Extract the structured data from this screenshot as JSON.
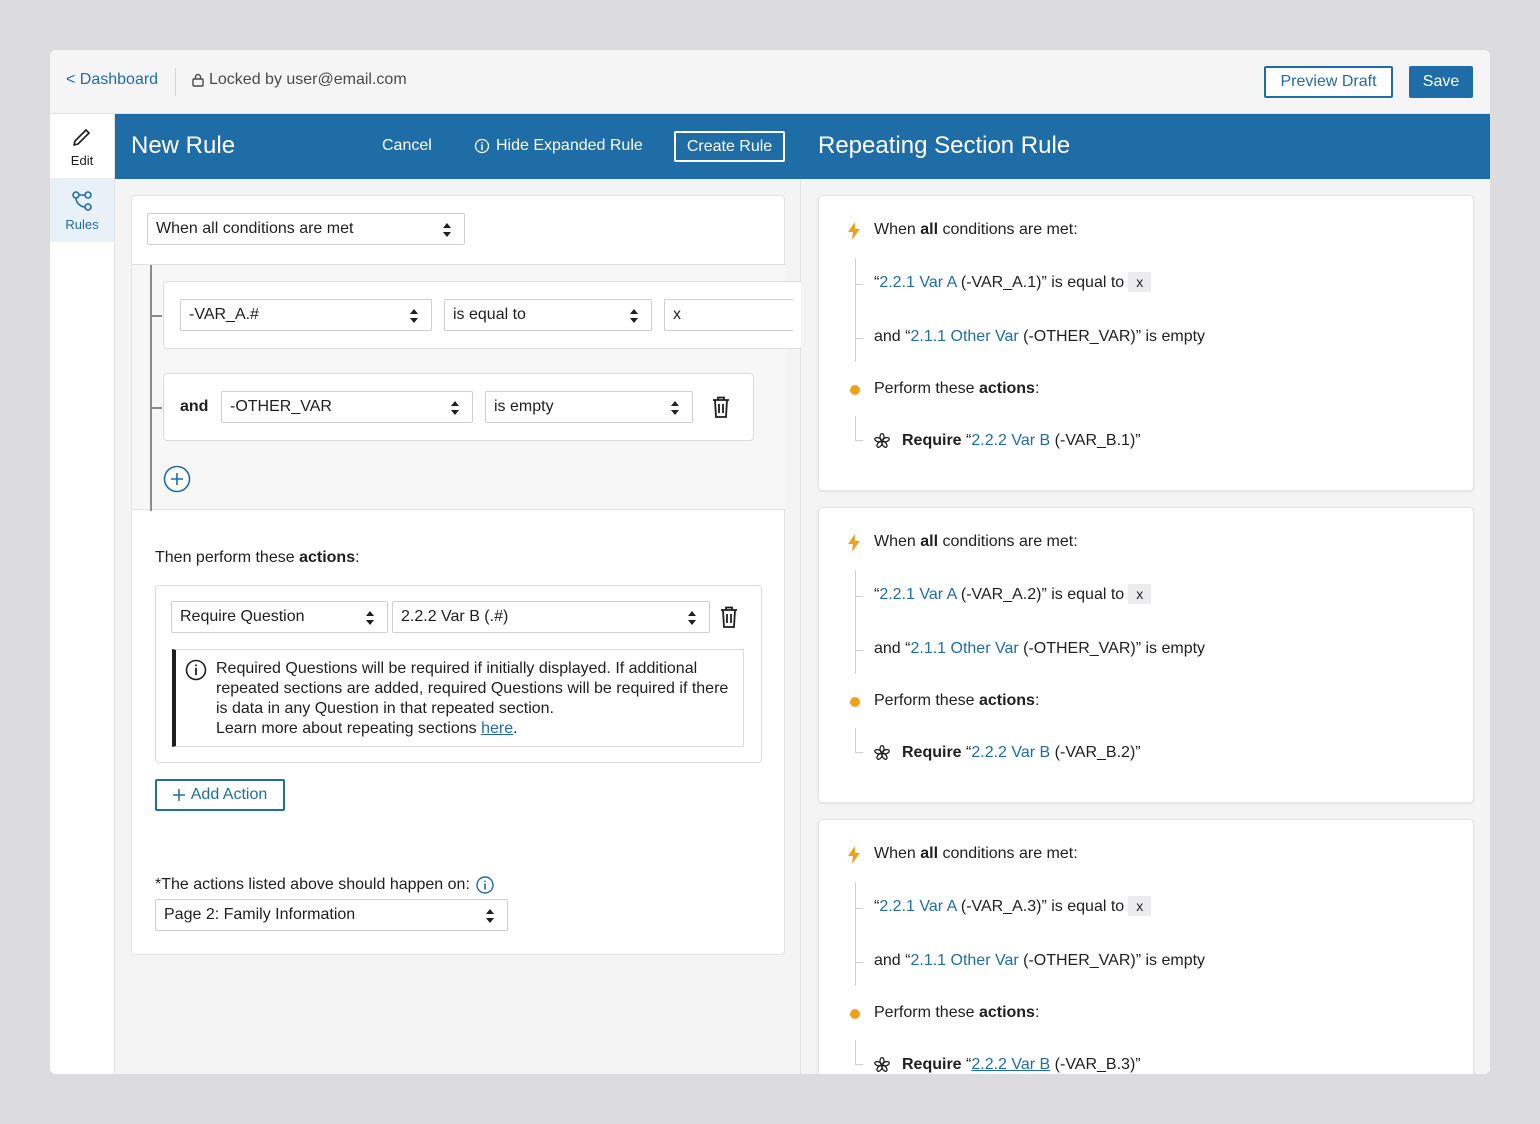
{
  "topbar": {
    "back_label": "< Dashboard",
    "locked_label": "Locked by user@email.com",
    "preview_label": "Preview Draft",
    "save_label": "Save"
  },
  "rail": {
    "edit_label": "Edit",
    "rules_label": "Rules"
  },
  "editor": {
    "title": "New Rule",
    "cancel_label": "Cancel",
    "hide_label": "Hide Expanded Rule",
    "create_label": "Create Rule",
    "match_select": "When all conditions are met",
    "conditions": [
      {
        "prefix": "",
        "variable": "-VAR_A.#",
        "operator": "is equal to",
        "value": "x"
      },
      {
        "prefix": "and",
        "variable": "-OTHER_VAR",
        "operator": "is empty",
        "value": ""
      }
    ],
    "actions_intro": "Then perform these ",
    "actions_bold": "actions",
    "actions_colon": ":",
    "action": {
      "type": "Require Question",
      "target": "2.2.2 Var B (.#)",
      "info_text": "Required Questions will be required if initially displayed. If additional repeated sections are added, required Questions will be required if there is data in any Question in that repeated section.",
      "learn_more": "Learn more about repeating sections ",
      "learn_link": "here",
      "learn_end": "."
    },
    "add_action_label": "Add Action",
    "page_prompt": "*The actions listed above should happen on:",
    "page_select": "Page 2: Family Information"
  },
  "preview": {
    "title": "Repeating Section Rule",
    "rules": [
      {
        "when_pre": "When ",
        "when_bold": "all",
        "when_post": " conditions are met:",
        "c1_open": "“",
        "c1_link": "2.2.1 Var A",
        "c1_rest": " (-VAR_A.1)” is equal to",
        "c1_value": "x",
        "c2_pre": "and “",
        "c2_link": "2.1.1 Other Var",
        "c2_rest": " (-OTHER_VAR)” is empty",
        "perform_pre": "Perform these ",
        "perform_bold": "actions",
        "perform_post": ":",
        "req_bold": "Require",
        "req_open": " “",
        "req_link": "2.2.2 Var B",
        "req_rest": " (-VAR_B.1)”"
      },
      {
        "when_pre": "When ",
        "when_bold": "all",
        "when_post": " conditions are met:",
        "c1_open": "“",
        "c1_link": "2.2.1 Var A",
        "c1_rest": " (-VAR_A.2)” is equal to",
        "c1_value": "x",
        "c2_pre": "and “",
        "c2_link": "2.1.1 Other Var",
        "c2_rest": " (-OTHER_VAR)” is empty",
        "perform_pre": "Perform these ",
        "perform_bold": "actions",
        "perform_post": ":",
        "req_bold": "Require",
        "req_open": " “",
        "req_link": "2.2.2 Var B",
        "req_rest": " (-VAR_B.2)”"
      },
      {
        "when_pre": "When ",
        "when_bold": "all",
        "when_post": " conditions are met:",
        "c1_open": "“",
        "c1_link": "2.2.1 Var A",
        "c1_rest": " (-VAR_A.3)” is equal to",
        "c1_value": "x",
        "c2_pre": "and “",
        "c2_link": "2.1.1 Other Var",
        "c2_rest": " (-OTHER_VAR)” is empty",
        "perform_pre": "Perform these ",
        "perform_bold": "actions",
        "perform_post": ":",
        "req_bold": "Require",
        "req_open": " “",
        "req_link": "2.2.2 Var B",
        "req_rest": " (-VAR_B.3)”"
      }
    ]
  },
  "colors": {
    "brand": "#1f6da6",
    "accent": "#f0a11c"
  }
}
